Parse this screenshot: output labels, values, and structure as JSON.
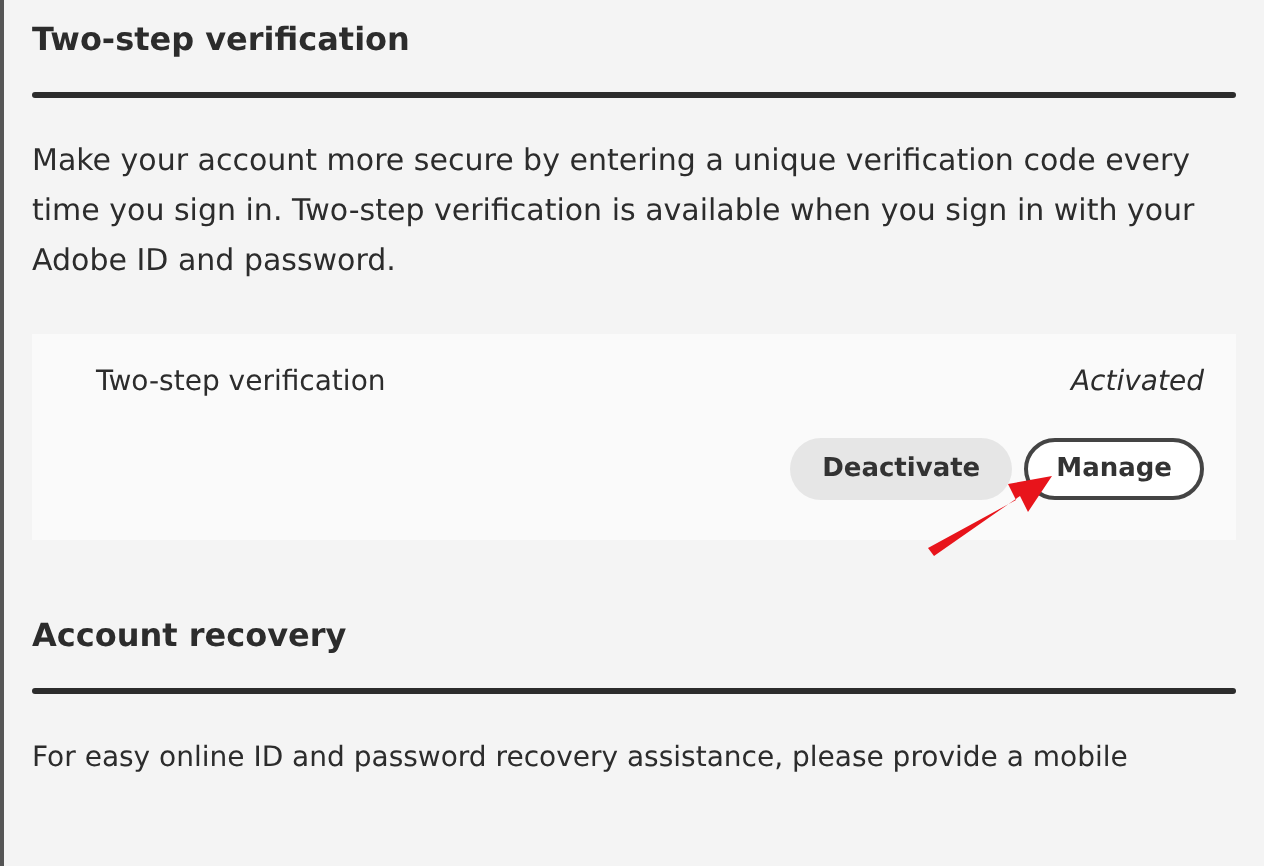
{
  "sections": [
    {
      "title": "Two-step verification",
      "description": "Make your account more secure by entering a unique verification code every time you sign in. Two-step verification is available when you sign in with your Adobe ID and password.",
      "setting": {
        "label": "Two-step verification",
        "status": "Activated",
        "buttons": [
          {
            "label": "Deactivate",
            "kind": "secondary"
          },
          {
            "label": "Manage",
            "kind": "outline"
          }
        ]
      }
    },
    {
      "title": "Account recovery",
      "description": "For easy online ID and password recovery assistance, please provide a mobile"
    }
  ]
}
